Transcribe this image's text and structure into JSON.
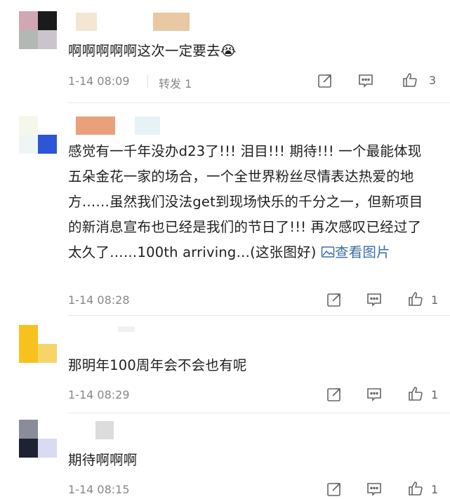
{
  "comments": [
    {
      "text": "啊啊啊啊啊这次一定要去😭",
      "time": "1-14 08:09",
      "forward": "转发 1",
      "likes": "3",
      "avatar_colors": [
        "#cfa8b3",
        "#1b1b1b",
        "#b4b8b4",
        "#cbc4cc"
      ],
      "name_colors": [
        "#f3e6d2",
        "#e8c9a3"
      ]
    },
    {
      "text": "感觉有一千年没办d23了!!! 泪目!!! 期待!!! 一个最能体现五朵金花一家的场合，一个全世界粉丝尽情表达热爱的地方……虽然我们没法get到现场快乐的千分之一，但新项目的新消息宣布也已经是我们的节日了!!! 再次感叹已经过了太久了……100th arriving…(这张图好)",
      "link": "查看图片",
      "time": "1-14 08:28",
      "likes": "1",
      "avatar_colors": [
        "#f5f7ea",
        "#ffffff",
        "#eef6f5",
        "#2e55d6"
      ],
      "name_colors": [
        "#e9a07b",
        "#e7f2f6"
      ]
    },
    {
      "text": "那明年100周年会不会也有呢",
      "time": "1-14 08:29",
      "likes": "1",
      "avatar_colors": [
        "#f7c21f",
        "#f6d46a"
      ],
      "name_colors": [
        "#f1f1f1"
      ]
    },
    {
      "text": "期待啊啊啊",
      "time": "1-14 08:15",
      "likes": "1",
      "avatar_colors": [
        "#8a8c99",
        "#1d2333",
        "#d9dbf2"
      ],
      "name_colors": [
        "#dcdcdc"
      ]
    }
  ],
  "icons": {
    "share": "share-icon",
    "comment": "comment-icon",
    "like": "thumbs-up-icon",
    "image_link": "image-link-icon"
  }
}
